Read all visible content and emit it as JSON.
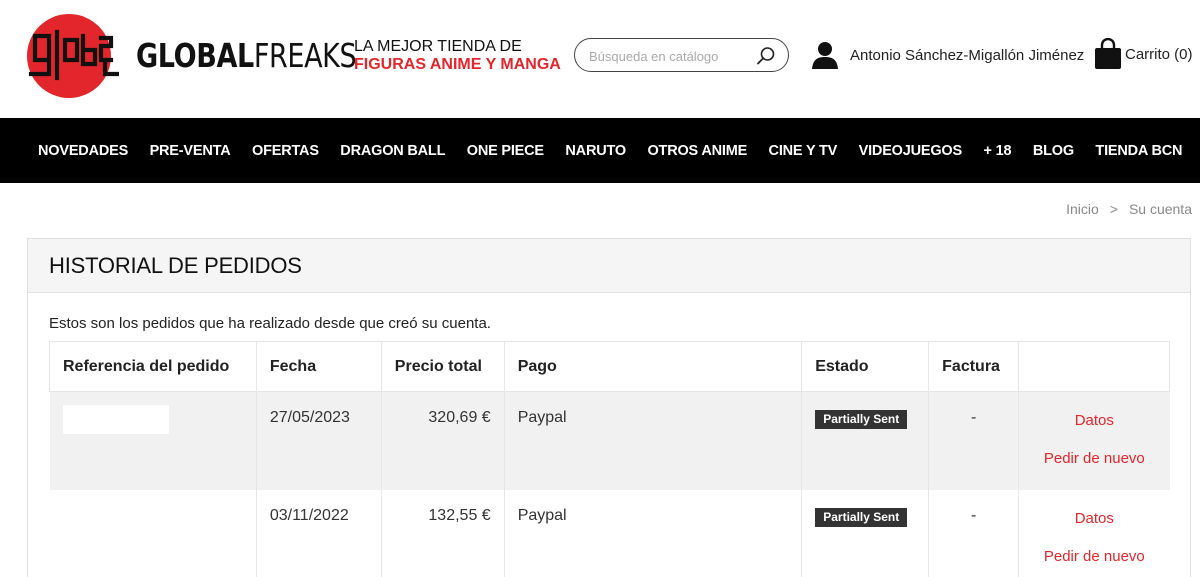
{
  "header": {
    "logo_alt": "GLOBAL",
    "brand_bold": "GLOBAL",
    "brand_light": "FREAKS",
    "tagline_line1": "LA MEJOR TIENDA DE",
    "tagline_line2": "FIGURAS ANIME Y MANGA",
    "search_placeholder": "Búsqueda en catálogo",
    "user_name": "Antonio Sánchez-Migallón Jiménez",
    "cart_label": "Carrito (0)",
    "brand_color": "#e3262b"
  },
  "nav": {
    "items": [
      "NOVEDADES",
      "PRE-VENTA",
      "OFERTAS",
      "DRAGON BALL",
      "ONE PIECE",
      "NARUTO",
      "OTROS ANIME",
      "CINE Y TV",
      "VIDEOJUEGOS",
      "+ 18",
      "BLOG",
      "TIENDA BCN"
    ]
  },
  "breadcrumb": {
    "home": "Inicio",
    "separator": ">",
    "current": "Su cuenta"
  },
  "page": {
    "title": "HISTORIAL DE PEDIDOS",
    "intro": "Estos son los pedidos que ha realizado desde que creó su cuenta."
  },
  "table": {
    "headers": [
      "Referencia del pedido",
      "Fecha",
      "Precio total",
      "Pago",
      "Estado",
      "Factura",
      ""
    ],
    "rows": [
      {
        "reference": "",
        "date": "27/05/2023",
        "total": "320,69 €",
        "payment": "Paypal",
        "status": "Partially Sent",
        "invoice": "-",
        "action_details": "Datos",
        "action_reorder": "Pedir de nuevo"
      },
      {
        "reference": "",
        "date": "03/11/2022",
        "total": "132,55 €",
        "payment": "Paypal",
        "status": "Partially Sent",
        "invoice": "-",
        "action_details": "Datos",
        "action_reorder": "Pedir de nuevo"
      }
    ]
  }
}
